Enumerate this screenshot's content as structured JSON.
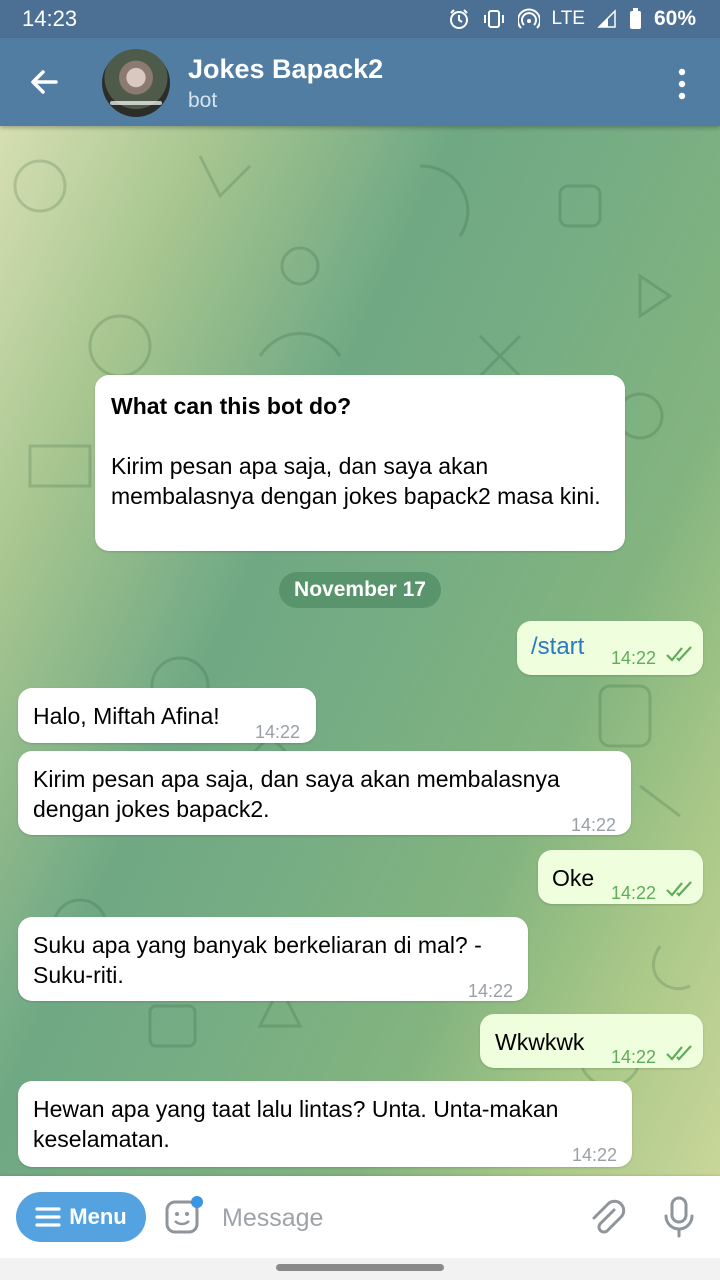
{
  "status_bar": {
    "time": "14:23",
    "network": "LTE",
    "battery": "60%",
    "icons": [
      "alarm-icon",
      "vibrate-icon",
      "hotspot-icon",
      "signal-icon",
      "battery-icon"
    ]
  },
  "header": {
    "title": "Jokes Bapack2",
    "subtitle": "bot",
    "icons": [
      "back-arrow-icon",
      "avatar",
      "more-vertical-icon"
    ]
  },
  "bot_info": {
    "title": "What can this bot do?",
    "description": "Kirim pesan apa saja, dan saya akan membalasnya dengan jokes bapack2 masa kini."
  },
  "date_divider": "November 17",
  "messages": [
    {
      "direction": "out",
      "text": "/start",
      "time": "14:22",
      "read": true
    },
    {
      "direction": "in",
      "text": "Halo, Miftah Afina!",
      "time": "14:22"
    },
    {
      "direction": "in",
      "text": "Kirim pesan apa saja, dan saya akan membalasnya dengan jokes bapack2.",
      "time": "14:22"
    },
    {
      "direction": "out",
      "text": "Oke",
      "time": "14:22",
      "read": true
    },
    {
      "direction": "in",
      "text": "Suku apa yang banyak berkeliaran di mal? -Suku-riti.",
      "time": "14:22"
    },
    {
      "direction": "out",
      "text": "Wkwkwk",
      "time": "14:22",
      "read": true
    },
    {
      "direction": "in",
      "text": "Hewan apa yang taat lalu lintas? Unta. Unta-makan keselamatan.",
      "time": "14:22"
    }
  ],
  "input_bar": {
    "menu_label": "Menu",
    "placeholder": "Message",
    "icons": [
      "sticker-icon",
      "attach-icon",
      "mic-icon"
    ]
  },
  "colors": {
    "header": "#517da2",
    "status_bar": "#4c6f94",
    "outgoing_bubble": "#effedd",
    "incoming_bubble": "#ffffff",
    "menu_button": "#55a2e0",
    "read_ticks": "#5fad5b"
  }
}
